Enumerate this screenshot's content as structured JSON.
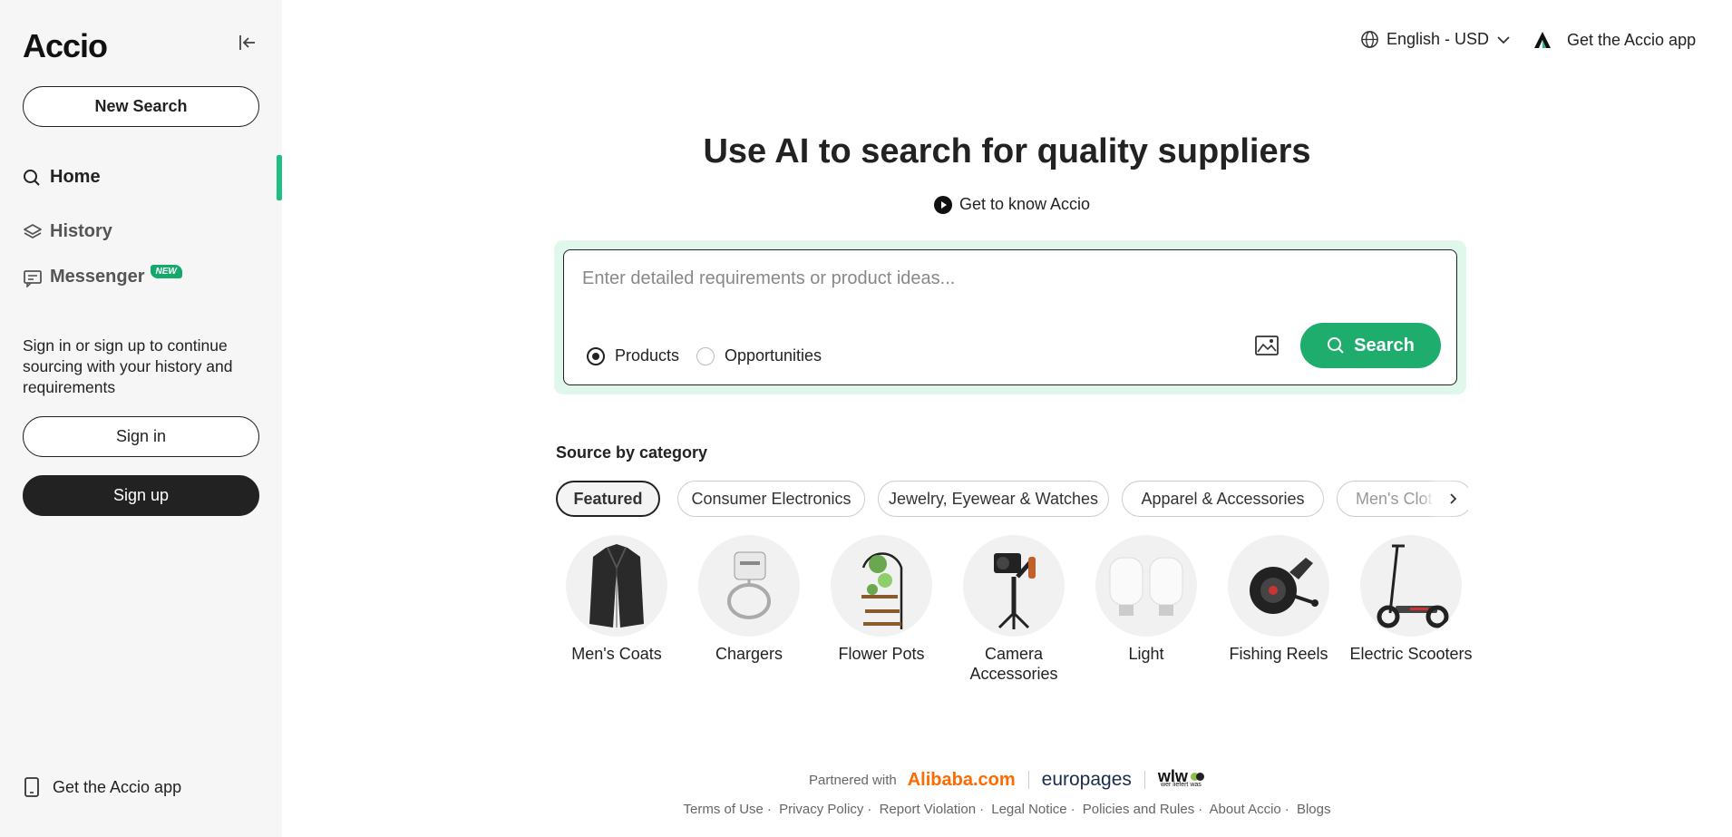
{
  "sidebar": {
    "logo": "Accio",
    "new_search": "New Search",
    "nav": [
      {
        "label": "Home"
      },
      {
        "label": "History"
      },
      {
        "label": "Messenger",
        "badge": "NEW"
      }
    ],
    "signin_prompt": "Sign in or sign up to continue sourcing with your history and requirements",
    "sign_in": "Sign in",
    "sign_up": "Sign up",
    "get_app": "Get the Accio app"
  },
  "topbar": {
    "language": "English - USD",
    "get_app": "Get the Accio app"
  },
  "hero": {
    "title": "Use AI to search for quality suppliers",
    "know_link": "Get to know Accio"
  },
  "search": {
    "placeholder": "Enter detailed requirements or product ideas...",
    "value": "",
    "options": [
      {
        "label": "Products",
        "selected": true
      },
      {
        "label": "Opportunities",
        "selected": false
      }
    ],
    "button": "Search"
  },
  "categories": {
    "title": "Source by category",
    "chips": [
      "Featured",
      "Consumer Electronics",
      "Jewelry, Eyewear & Watches",
      "Apparel & Accessories",
      "Men's Clot"
    ],
    "active_chip": "Featured"
  },
  "products": [
    {
      "name": "Men's Coats",
      "icon": "coat-icon"
    },
    {
      "name": "Chargers",
      "icon": "charger-icon"
    },
    {
      "name": "Flower Pots",
      "icon": "flower-pot-icon"
    },
    {
      "name": "Camera Accessories",
      "icon": "camera-gimbal-icon"
    },
    {
      "name": "Light",
      "icon": "light-bulb-icon"
    },
    {
      "name": "Fishing Reels",
      "icon": "fishing-reel-icon"
    },
    {
      "name": "Electric Scooters",
      "icon": "scooter-icon"
    }
  ],
  "footer": {
    "partnered_with": "Partnered with",
    "partners": [
      "Alibaba.com",
      "europages",
      "wlw"
    ],
    "wlw_tagline": "wer liefert was",
    "links": [
      "Terms of Use",
      "Privacy Policy",
      "Report Violation",
      "Legal Notice",
      "Policies and Rules",
      "About Accio",
      "Blogs"
    ]
  },
  "colors": {
    "accent": "#1fad6d",
    "accent_light": "#e0f7ec",
    "sidebar_bg": "#f6f6f6",
    "alibaba": "#ff6a00"
  }
}
